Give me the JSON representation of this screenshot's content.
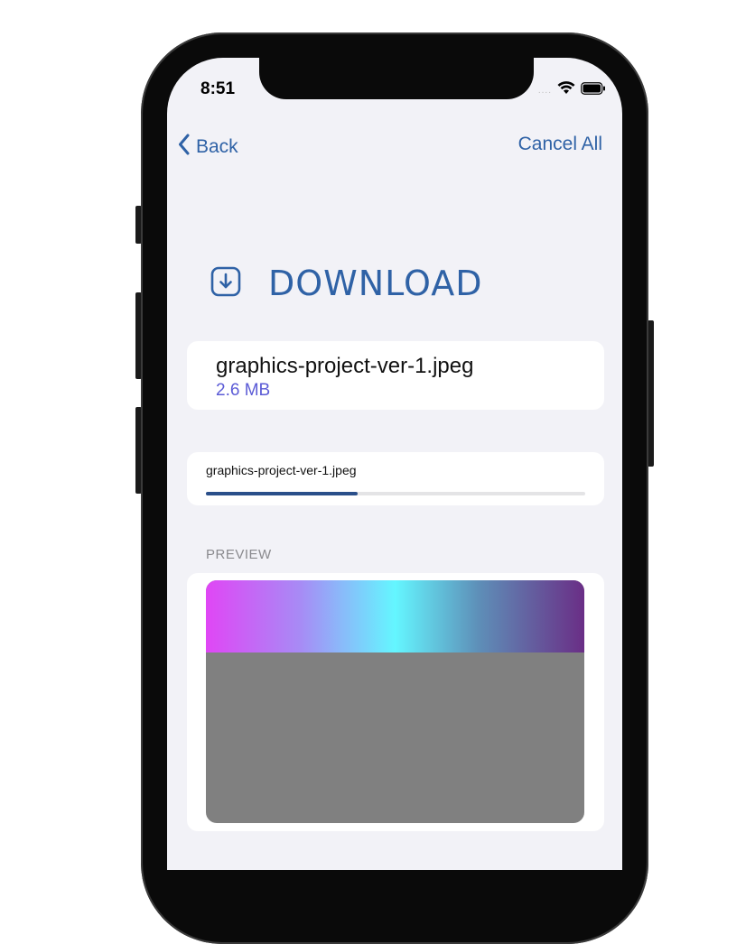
{
  "status_bar": {
    "time": "8:51",
    "signal_dots": "....",
    "icons": [
      "wifi-icon",
      "battery-icon"
    ]
  },
  "nav": {
    "back_label": "Back",
    "cancel_label": "Cancel All",
    "accent_color": "#2f62a6"
  },
  "header": {
    "icon": "download-icon",
    "title": "DOWNLOAD"
  },
  "file": {
    "name": "graphics-project-ver-1.jpeg",
    "size": "2.6 MB",
    "size_color": "#5b5bd6"
  },
  "progress": {
    "label": "graphics-project-ver-1.jpeg",
    "fraction": 0.4,
    "fill_color": "#2a4f8a"
  },
  "preview": {
    "label": "PREVIEW"
  }
}
